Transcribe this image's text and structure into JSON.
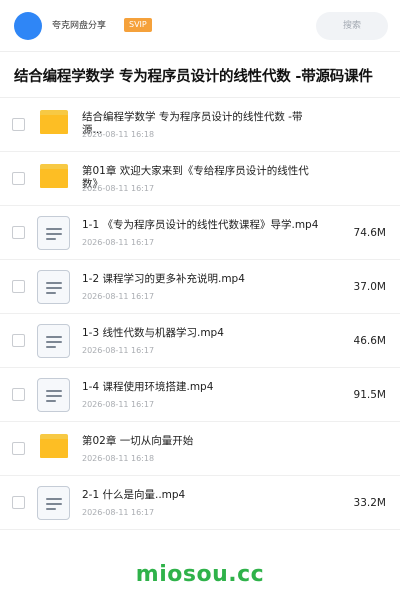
{
  "header": {
    "user_name": "夸克网盘分享",
    "badge": "SVIP",
    "search_placeholder": "搜索"
  },
  "page_title": "结合编程学数学 专为程序员设计的线性代数 -带源码课件",
  "files": [
    {
      "type": "folder",
      "name": "结合编程学数学 专为程序员设计的线性代数 -带源...",
      "date": "2026-08-11 16:18",
      "size": ""
    },
    {
      "type": "folder",
      "name": "第01章 欢迎大家来到《专给程序员设计的线性代数》",
      "date": "2026-08-11 16:17",
      "size": ""
    },
    {
      "type": "file",
      "name": "1-1 《专为程序员设计的线性代数课程》导学.mp4",
      "date": "2026-08-11 16:17",
      "size": "74.6M"
    },
    {
      "type": "file",
      "name": "1-2 课程学习的更多补充说明.mp4",
      "date": "2026-08-11 16:17",
      "size": "37.0M"
    },
    {
      "type": "file",
      "name": "1-3 线性代数与机器学习.mp4",
      "date": "2026-08-11 16:17",
      "size": "46.6M"
    },
    {
      "type": "file",
      "name": "1-4 课程使用环境搭建.mp4",
      "date": "2026-08-11 16:17",
      "size": "91.5M"
    },
    {
      "type": "folder",
      "name": "第02章 一切从向量开始",
      "date": "2026-08-11 16:18",
      "size": ""
    },
    {
      "type": "file",
      "name": "2-1 什么是向量..mp4",
      "date": "2026-08-11 16:17",
      "size": "33.2M"
    }
  ],
  "watermark": "miosou.cc",
  "colors": {
    "avatar": "#2f86f6",
    "badge": "#f5a13b",
    "folder": "#fdbe24",
    "watermark": "#2fb24a"
  },
  "icons": {
    "folder": "folder-icon",
    "file": "video-file-icon"
  }
}
